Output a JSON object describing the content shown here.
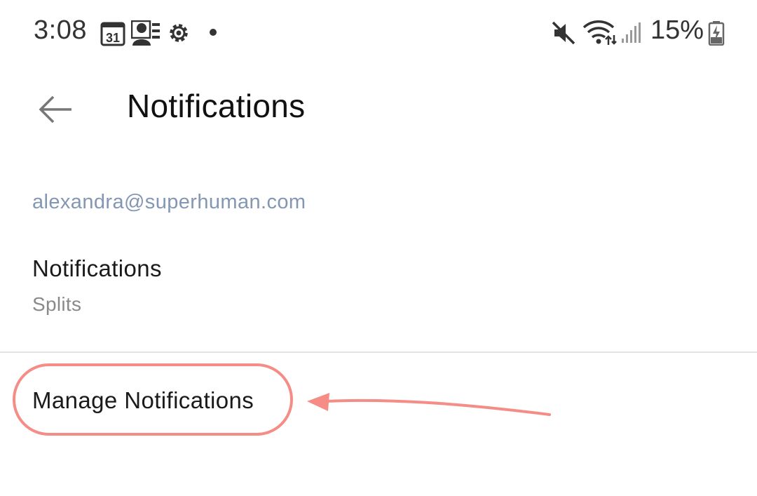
{
  "status_bar": {
    "time": "3:08",
    "calendar_day": "31",
    "battery_percent": "15%",
    "icons": [
      "calendar-icon",
      "contacts-icon",
      "settings-gear-icon",
      "notification-dot-icon",
      "mute-icon",
      "wifi-icon",
      "signal-icon",
      "battery-charging-icon"
    ]
  },
  "app_bar": {
    "back_icon": "arrow-left-icon",
    "title": "Notifications"
  },
  "account": {
    "email": "alexandra@superhuman.com"
  },
  "settings": {
    "notifications_title": "Notifications",
    "notifications_value": "Splits",
    "manage_label": "Manage Notifications"
  },
  "colors": {
    "accent_email": "#8397b4",
    "annotation": "#f58c86",
    "divider": "#e4e4e4"
  }
}
